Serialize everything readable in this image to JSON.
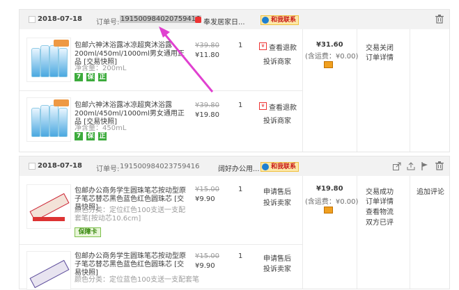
{
  "orders": [
    {
      "date": "2018-07-18",
      "order_no_label": "订单号:",
      "order_no": "191500984020759416",
      "shop": "奉发居家日...",
      "chat_label": "和我联系",
      "total": "¥31.60",
      "shipping": "(含运费：¥0.00)",
      "status": "交易关闭",
      "detail": "订单详情",
      "items": [
        {
          "title": "包邮六神沐浴露冰凉超爽沐浴露200ml/450ml/1000ml男女通用正品 [交易快照]",
          "spec": "净含量：200mL",
          "orig": "¥39.80",
          "price": "¥11.80",
          "qty": "1",
          "act1": "查看退款",
          "act2": "投诉商家",
          "badges": [
            "7",
            "保",
            "正"
          ]
        },
        {
          "title": "包邮六神沐浴露冰凉超爽沐浴露200ml/450ml/1000ml男女通用正品 [交易快照]",
          "spec": "净含量：450mL",
          "orig": "¥39.80",
          "price": "¥19.80",
          "qty": "1",
          "act1": "查看退款",
          "act2": "投诉商家",
          "badges": [
            "7",
            "保",
            "正"
          ]
        }
      ]
    },
    {
      "date": "2018-07-18",
      "order_no_label": "订单号:",
      "order_no": "191500984023759416",
      "shop": "阔好办公用...",
      "chat_label": "和我联系",
      "total": "¥19.80",
      "shipping": "(含运费：¥0.00)",
      "status": "交易成功",
      "detail": "订单详情",
      "logistics": "查看物流",
      "review_status": "双方已评",
      "extra": "追加评论",
      "items": [
        {
          "title": "包邮办公商务学生圆珠笔芯按动型原子笔芯替芯黑色蓝色红色圆珠芯 [交易快照]",
          "spec": "颜色分类：定位红色100支送一支配套笔[按动芯10.6cm]",
          "orig": "¥15.00",
          "price": "¥9.90",
          "qty": "1",
          "act1": "申请售后",
          "act2": "投诉卖家",
          "badge": "保障卡"
        },
        {
          "title": "包邮办公商务学生圆珠笔芯按动型原子笔芯替芯黑色蓝色红色圆珠芯 [交易快照]",
          "spec": "颜色分类：定位蓝色100支送一支配套笔",
          "orig": "¥15.00",
          "price": "¥9.90",
          "qty": "1",
          "act1": "申请售后",
          "act2": "投诉卖家"
        }
      ]
    }
  ],
  "icons": {
    "trash": "trash-icon",
    "share": "share-icon",
    "flag": "flag-icon",
    "upload": "upload-icon"
  },
  "colors": {
    "arrow": "#e040d0",
    "chat_bg": "#fce8a8",
    "header_bg": "#f2f2f2"
  }
}
